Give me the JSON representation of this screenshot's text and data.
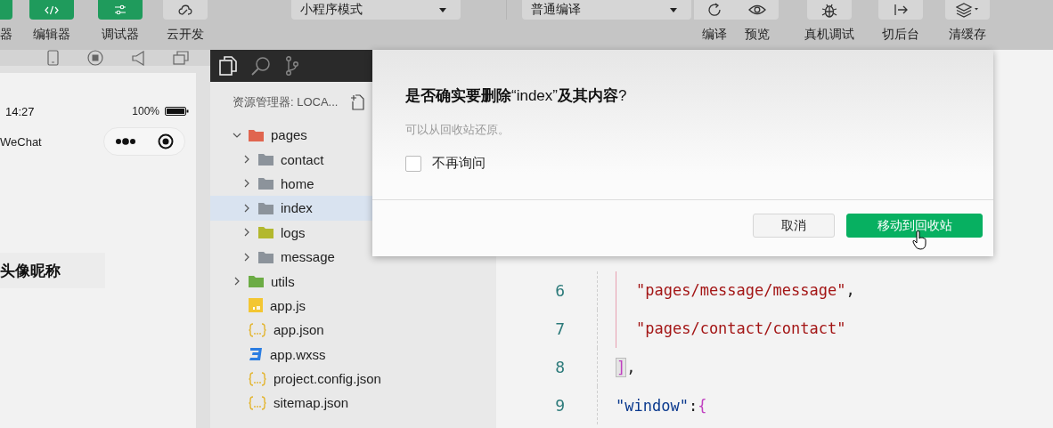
{
  "toolbar": {
    "left_tools": [
      {
        "label": "器",
        "active": true
      },
      {
        "label": "编辑器",
        "active": true
      },
      {
        "label": "调试器",
        "active": true
      },
      {
        "label": "云开发",
        "active": false
      }
    ],
    "dropdowns": [
      {
        "value": "小程序模式"
      },
      {
        "value": "普通编译"
      }
    ],
    "right_tools": [
      {
        "label": "编译"
      },
      {
        "label": "预览"
      },
      {
        "label": "真机调试"
      },
      {
        "label": "切后台"
      },
      {
        "label": "清缓存"
      }
    ]
  },
  "simulator": {
    "status_time": "14:27",
    "battery": "100%",
    "nav_title": "WeChat",
    "content_text": "头像昵称"
  },
  "explorer": {
    "title": "资源管理器: LOCA...",
    "tree": [
      {
        "name": "pages",
        "kind": "folder",
        "color": "#e0654f",
        "expanded": true,
        "selected": false,
        "children": [
          {
            "name": "contact",
            "kind": "folder",
            "color": "#8c939b",
            "expanded": false,
            "selected": false
          },
          {
            "name": "home",
            "kind": "folder",
            "color": "#8c939b",
            "expanded": false,
            "selected": false
          },
          {
            "name": "index",
            "kind": "folder",
            "color": "#8c939b",
            "expanded": false,
            "selected": true
          },
          {
            "name": "logs",
            "kind": "folder",
            "color": "#b3b82e",
            "expanded": false,
            "selected": false
          },
          {
            "name": "message",
            "kind": "folder",
            "color": "#8c939b",
            "expanded": false,
            "selected": false
          }
        ]
      },
      {
        "name": "utils",
        "kind": "folder",
        "color": "#6cac45",
        "expanded": false,
        "selected": false
      },
      {
        "name": "app.js",
        "kind": "js",
        "selected": false
      },
      {
        "name": "app.json",
        "kind": "json",
        "selected": false
      },
      {
        "name": "app.wxss",
        "kind": "wxss",
        "selected": false
      },
      {
        "name": "project.config.json",
        "kind": "json",
        "selected": false
      },
      {
        "name": "sitemap.json",
        "kind": "json",
        "selected": false
      }
    ]
  },
  "editor": {
    "lines": [
      {
        "number": "6",
        "indented": true,
        "tokens": [
          {
            "text": "\"pages/message/message\"",
            "kind": "string"
          },
          {
            "text": ",",
            "kind": "punct"
          }
        ]
      },
      {
        "number": "7",
        "indented": true,
        "tokens": [
          {
            "text": "\"pages/contact/contact\"",
            "kind": "string"
          }
        ]
      },
      {
        "number": "8",
        "indented": false,
        "tokens": [
          {
            "text": "]",
            "kind": "bracket"
          },
          {
            "text": ",",
            "kind": "punct"
          }
        ]
      },
      {
        "number": "9",
        "indented": false,
        "tokens": [
          {
            "text": "\"window\"",
            "kind": "key"
          },
          {
            "text": ":",
            "kind": "punct"
          },
          {
            "text": "{",
            "kind": "brace"
          }
        ]
      }
    ]
  },
  "dialog": {
    "title": "**是否确实要删除**“index”**及其内容**?",
    "message": "可以从回收站还原。",
    "checkbox": {
      "label": "不再询问",
      "checked": false
    },
    "buttons": [
      {
        "label": "取消",
        "primary": false
      },
      {
        "label": "移动到回收站",
        "primary": true
      }
    ]
  }
}
